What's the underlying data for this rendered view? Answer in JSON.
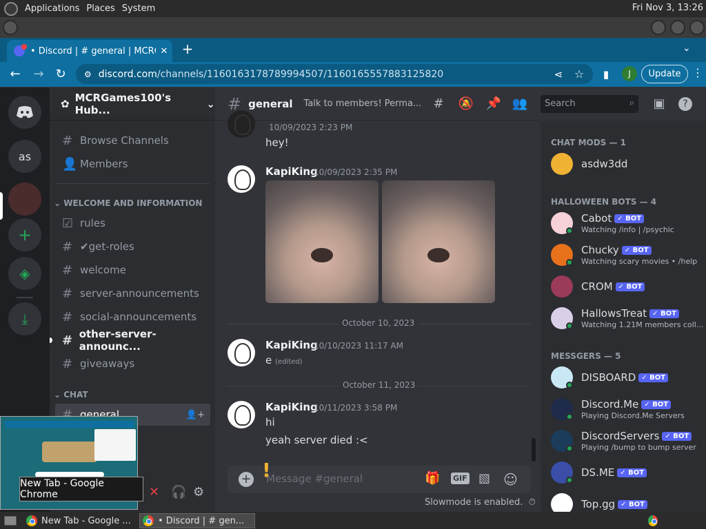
{
  "desktop": {
    "menus": [
      "Applications",
      "Places",
      "System"
    ],
    "clock": "Fri Nov 3, 13:26"
  },
  "browser": {
    "tab_title": "• Discord | # general | MCRGa",
    "new_tab": "+",
    "url_host": "discord.com",
    "url_path": "/channels/1160163178789994507/1160165557883125820",
    "profile_initial": "J",
    "update_label": "Update"
  },
  "servers": {
    "dm_label": "as"
  },
  "guild": {
    "name": "MCRGames100's Hub...",
    "browse": "Browse Channels",
    "members": "Members",
    "categories": [
      "WELCOME AND INFORMATION",
      "CHAT"
    ],
    "channels": [
      {
        "name": "rules",
        "icon": "rules-icon"
      },
      {
        "name": "✔get-roles",
        "icon": "hash"
      },
      {
        "name": "welcome",
        "icon": "hash"
      },
      {
        "name": "server-announcements",
        "icon": "hash"
      },
      {
        "name": "social-announcements",
        "icon": "hash"
      },
      {
        "name": "other-server-announc...",
        "icon": "hash"
      },
      {
        "name": "giveaways",
        "icon": "hash"
      },
      {
        "name": "general",
        "icon": "hash"
      }
    ]
  },
  "chat": {
    "channel": "general",
    "topic": "Talk to members! Perma...",
    "search_placeholder": "Search",
    "messages": [
      {
        "author": "",
        "time": "10/09/2023 2:23 PM",
        "text": "hey!"
      },
      {
        "author": "KapiKing",
        "time": "10/09/2023 2:35 PM",
        "text": ""
      },
      {
        "author": "KapiKing",
        "time": "10/10/2023 11:17 AM",
        "text": "e",
        "edited": "(edited)"
      },
      {
        "author": "KapiKing",
        "time": "10/11/2023 3:58 PM",
        "text": "hi",
        "text2": "yeah server died :<"
      }
    ],
    "dividers": [
      "October 10, 2023",
      "October 11, 2023"
    ],
    "composer_placeholder": "Message #general",
    "slowmode": "Slowmode is enabled."
  },
  "members": {
    "groups": [
      {
        "title": "CHAT MODS — 1",
        "members": [
          {
            "name": "asdw3dd"
          }
        ]
      },
      {
        "title": "HALLOWEEN BOTS — 4",
        "members": [
          {
            "name": "Cabot",
            "bot": "✓ BOT",
            "activity": "Watching /info | /psychic"
          },
          {
            "name": "Chucky",
            "bot": "✓ BOT",
            "activity": "Watching scary movies • /help"
          },
          {
            "name": "CROM",
            "bot": "✓ BOT"
          },
          {
            "name": "HallowsTreat",
            "bot": "✓ BOT",
            "activity": "Watching 1.21M members coll..."
          }
        ]
      },
      {
        "title": "MESSGERS — 5",
        "members": [
          {
            "name": "DISBOARD",
            "bot": "✓ BOT"
          },
          {
            "name": "Discord.Me",
            "bot": "✓ BOT",
            "activity": "Playing Discord.Me Servers"
          },
          {
            "name": "DiscordServers",
            "bot": "✓ BOT",
            "activity": "Playing /bump to bump server"
          },
          {
            "name": "DS.ME",
            "bot": "✓ BOT"
          },
          {
            "name": "Top.gg",
            "bot": "✓ BOT"
          }
        ]
      }
    ]
  },
  "taskbar": {
    "tooltip": "New Tab - Google Chrome",
    "tasks": [
      "New Tab - Google ...",
      "• Discord | # gen..."
    ]
  },
  "colors": {
    "blurple": "#5865f2",
    "online": "#23a559",
    "chrome_blue": "#0e6fa0"
  }
}
